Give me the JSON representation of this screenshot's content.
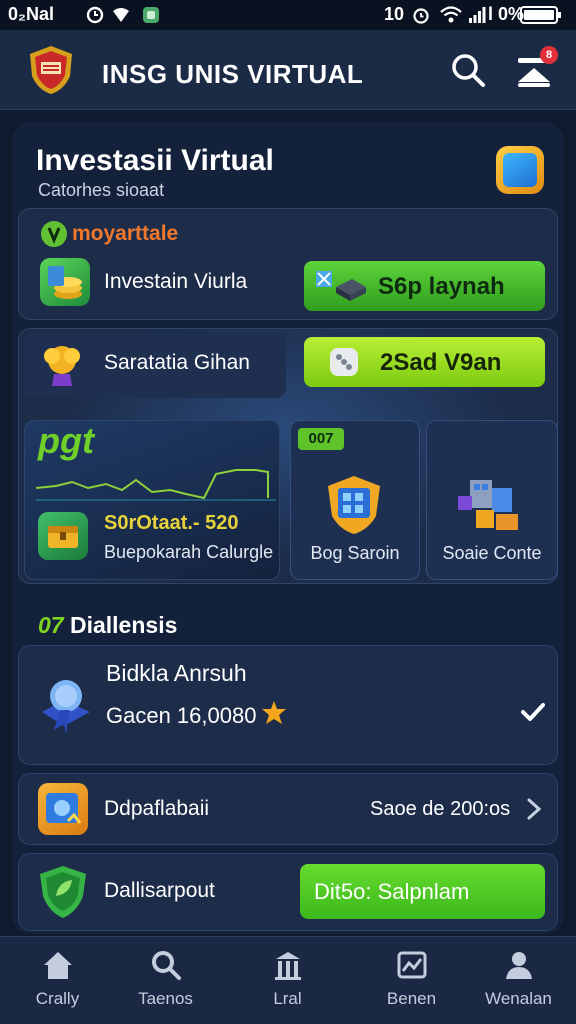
{
  "status_bar": {
    "left_text": "0₂Nal",
    "right_text": "10",
    "battery_text": "l 0%"
  },
  "header": {
    "title": "INSG UNIS VIRTUAL"
  },
  "page": {
    "title": "Investasii Virtual",
    "subtitle": "Catorhes sioaat"
  },
  "tag_card": {
    "tag_label": "moyarttale",
    "item_label": "Investain Viurla",
    "button_label": "S6p laynah"
  },
  "market_card": {
    "item_label": "Saratatia Gihan",
    "button_label": "2Sad V9an",
    "chart_tag": "pgt",
    "stat_value": "S0rOtaat.- 520",
    "stat_label": "Buepokarah Calurgle",
    "tile1_badge": "007",
    "tile1_label": "Bog Saroin",
    "tile2_label": "Soaie Conte"
  },
  "section": {
    "number": "07",
    "title": "Diallensis"
  },
  "offer_card": {
    "title": "Bidkla Anrsuh",
    "amount_text": "Gacen 16,0080"
  },
  "row_card": {
    "label": "Ddpaflabaii",
    "value": "Saoe de 200:os"
  },
  "bottom_card": {
    "label": "Dallisarpout",
    "button_label": "Dit5o: Salpnlam"
  },
  "bottom_nav": [
    {
      "label": "Crally",
      "icon": "home-icon"
    },
    {
      "label": "Taenos",
      "icon": "search-icon"
    },
    {
      "label": "Lral",
      "icon": "building-icon"
    },
    {
      "label": "Benen",
      "icon": "chart-icon"
    },
    {
      "label": "Wenalan",
      "icon": "user-icon"
    }
  ],
  "colors": {
    "background": "#101a2e",
    "panel": "#1c2c49",
    "accent_green": "#4cc22c",
    "accent_lime": "#a6e62a",
    "tag_orange": "#f0782c"
  }
}
